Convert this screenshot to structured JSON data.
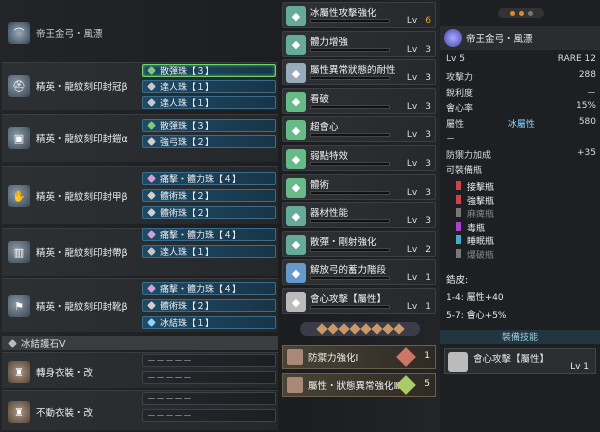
{
  "charm": {
    "label": "帝王金弓・風漂"
  },
  "equipment": [
    {
      "name": "精英・龍紋刻印封冠β",
      "slots": [
        "散彈珠【３】",
        "達人珠【１】",
        "達人珠【１】"
      ]
    },
    {
      "name": "精英・龍紋刻印封鎧α",
      "slots": [
        "散彈珠【３】",
        "強弓珠【２】"
      ]
    },
    {
      "name": "精英・龍紋刻印封甲β",
      "slots": [
        "痛擊・體力珠【４】",
        "體術珠【２】",
        "體術珠【２】"
      ]
    },
    {
      "name": "精英・龍紋刻印封帶β",
      "slots": [
        "痛擊・體力珠【４】",
        "達人珠【１】"
      ]
    },
    {
      "name": "精英・龍紋刻印封靴β",
      "slots": [
        "痛擊・體力珠【４】",
        "體術珠【２】",
        "冰結珠【１】"
      ]
    }
  ],
  "charm_section": "冰結護石Ⅴ",
  "mantles": [
    {
      "name": "轉身衣裝・改",
      "slots": [
        "－－－－－",
        "－－－－－"
      ]
    },
    {
      "name": "不動衣裝・改",
      "slots": [
        "－－－－－",
        "－－－－－"
      ]
    }
  ],
  "skills": [
    {
      "name": "冰屬性攻擊強化",
      "lv": "6",
      "max": true
    },
    {
      "name": "體力增強",
      "lv": "3"
    },
    {
      "name": "屬性異常狀態的耐性",
      "lv": "3"
    },
    {
      "name": "看破",
      "lv": "3"
    },
    {
      "name": "超會心",
      "lv": "3"
    },
    {
      "name": "弱點特效",
      "lv": "3"
    },
    {
      "name": "體術",
      "lv": "3"
    },
    {
      "name": "器材性能",
      "lv": "3"
    },
    {
      "name": "散彈・剛射強化",
      "lv": "2"
    },
    {
      "name": "解放弓的蓄力階段",
      "lv": "1"
    },
    {
      "name": "會心攻擊【屬性】",
      "lv": "1"
    }
  ],
  "lv_prefix": "Lv",
  "set_bonuses": [
    {
      "name": "防禦力強化Ⅰ",
      "count": "1"
    },
    {
      "name": "屬性・狀態異常強化Ⅲ",
      "count": "5"
    }
  ],
  "weapon": {
    "name": "帝王金弓・風漂",
    "lv": "Lv 5",
    "rare": "RARE 12",
    "stats": [
      {
        "label": "攻擊力",
        "value": "288"
      },
      {
        "label": "銳利度",
        "value": "－"
      },
      {
        "label": "會心率",
        "value": "15%"
      },
      {
        "label": "屬性",
        "value": "580",
        "elem": "冰屬性"
      },
      {
        "label": "－",
        "value": ""
      },
      {
        "label": "防禦力加成",
        "value": "+35"
      },
      {
        "label": "可裝備瓶",
        "value": ""
      }
    ],
    "coatings": [
      "接擊瓶",
      "強擊瓶",
      "麻痺瓶",
      "毒瓶",
      "睡眠瓶",
      "爆破瓶"
    ],
    "notes_title": "鋯皮:",
    "notes": [
      "1-4: 屬性+40",
      "5-7: 會心+5%"
    ],
    "skill_header": "裝備技能",
    "equip_skill": {
      "name": "會心攻擊【屬性】",
      "lv": "Lv 1"
    }
  },
  "colors": {
    "accent": "#e08a2c",
    "deco_blue": "#1f4a66",
    "ice": "#8ad4ff"
  }
}
